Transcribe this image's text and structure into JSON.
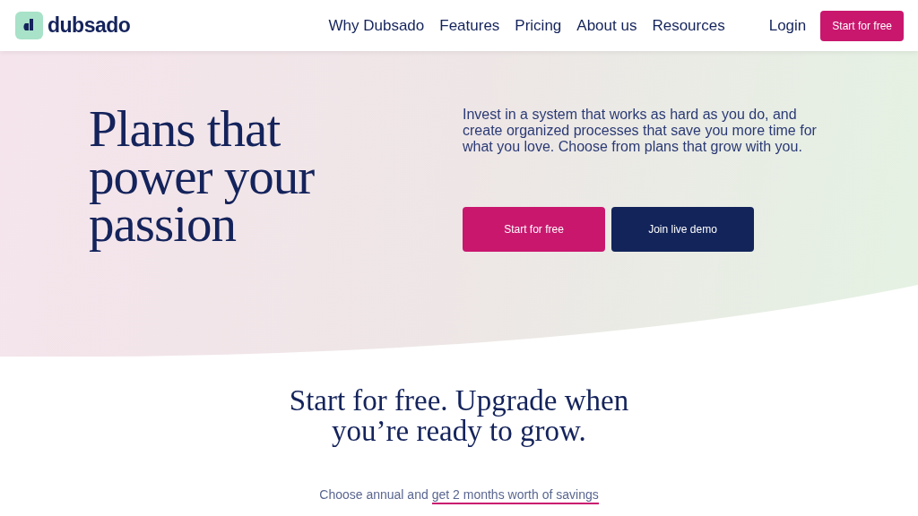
{
  "logo": {
    "text": "dubsado"
  },
  "nav": {
    "links": [
      "Why Dubsado",
      "Features",
      "Pricing",
      "About us",
      "Resources"
    ],
    "login": "Login",
    "cta": "Start for free"
  },
  "hero": {
    "title": "Plans that power your passion",
    "text": "Invest in a system that works as hard as you do, and create organized processes that save you more time for what you love. Choose from plans that grow with you.",
    "buttons": [
      {
        "label": "Start for free",
        "kind": "primary"
      },
      {
        "label": "Join live demo",
        "kind": "secondary"
      }
    ]
  },
  "pricing": {
    "title": "Start for free. Upgrade when you’re ready to grow.",
    "note": "Choose annual and",
    "note_link": "get 2 months worth of savings"
  }
}
